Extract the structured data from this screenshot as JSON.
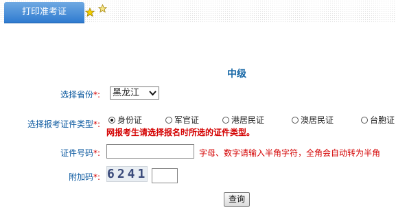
{
  "tab": {
    "label": "打印准考证"
  },
  "level_title": "中级",
  "province": {
    "label": "选择省份",
    "required_mark": "*:",
    "selected": "黑龙江"
  },
  "id_type": {
    "label": "选择报考证件类型",
    "required_mark": "*:",
    "options": [
      "身份证",
      "军官证",
      "港居民证",
      "澳居民证",
      "台胞证"
    ],
    "selected_index": 0,
    "hint": "网报考生请选择报名时所选的证件类型。"
  },
  "id_number": {
    "label": "证件号码",
    "required_mark": "*:",
    "value": "",
    "hint": "字母、数字请输入半角字符，全角会自动转为半角"
  },
  "captcha": {
    "label": "附加码",
    "required_mark": "*:",
    "image_text": "6241",
    "value": ""
  },
  "submit": {
    "label": "查询"
  },
  "colors": {
    "label": "#0d5aa0",
    "required": "#d40000",
    "tab": "#3d86d6",
    "title": "#1a6aa8"
  }
}
